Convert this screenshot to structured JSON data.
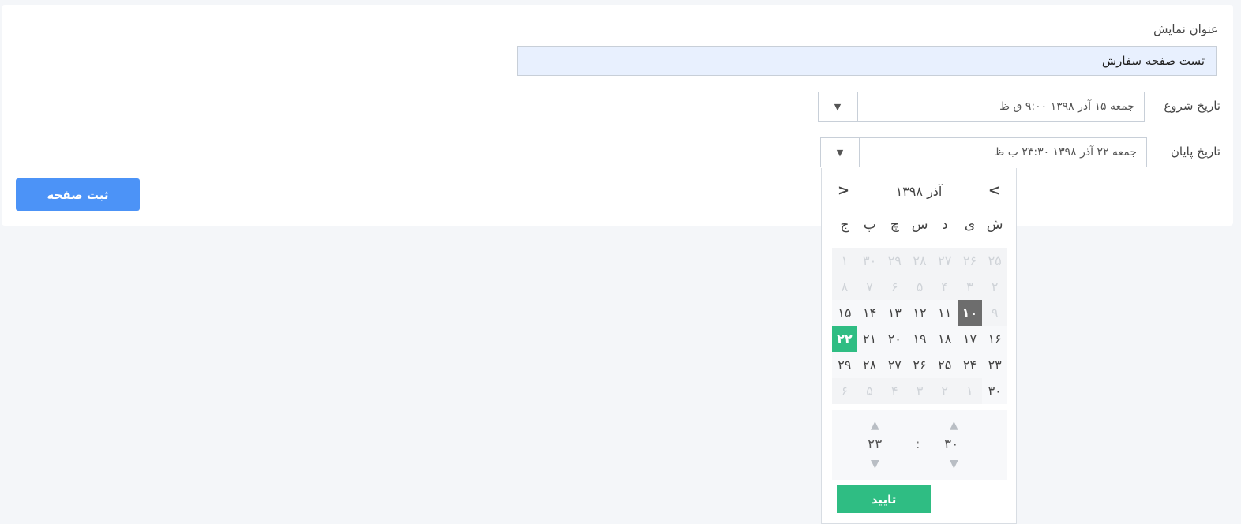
{
  "form": {
    "display_title_label": "عنوان نمایش",
    "display_title_value": "تست صفحه سفارش",
    "start_label": "تاریخ شروع",
    "start_value": "جمعه ۱۵ آذر ۱۳۹۸  ۹:۰۰  ق ظ",
    "end_label": "تاریخ پایان",
    "end_value": "جمعه ۲۲ آذر ۱۳۹۸  ۲۳:۳۰  ب ظ",
    "dropdown_glyph": "▼",
    "submit_label": "ثبت صفحه"
  },
  "picker": {
    "month_title": "آذر ۱۳۹۸",
    "prev_glyph": "<",
    "next_glyph": ">",
    "weekdays": [
      "ش",
      "ی",
      "د",
      "س",
      "چ",
      "پ",
      "ج"
    ],
    "days": [
      "۲۵",
      "۲۶",
      "۲۷",
      "۲۸",
      "۲۹",
      "۳۰",
      "۱",
      "۲",
      "۳",
      "۴",
      "۵",
      "۶",
      "۷",
      "۸",
      "۹",
      "۱۰",
      "۱۱",
      "۱۲",
      "۱۳",
      "۱۴",
      "۱۵",
      "۱۶",
      "۱۷",
      "۱۸",
      "۱۹",
      "۲۰",
      "۲۱",
      "۲۲",
      "۲۳",
      "۲۴",
      "۲۵",
      "۲۶",
      "۲۷",
      "۲۸",
      "۲۹",
      "۳۰",
      "۱",
      "۲",
      "۳",
      "۴",
      "۵",
      "۶"
    ],
    "time": {
      "minute": "۳۰",
      "hour": "۲۳",
      "separator": ":",
      "up_glyph": "▲",
      "down_glyph": "▼"
    },
    "confirm_label": "تایید"
  },
  "colors": {
    "accent_blue": "#4c93f7",
    "accent_green": "#2fbd83",
    "current_day_bg": "#6d6d6d"
  }
}
